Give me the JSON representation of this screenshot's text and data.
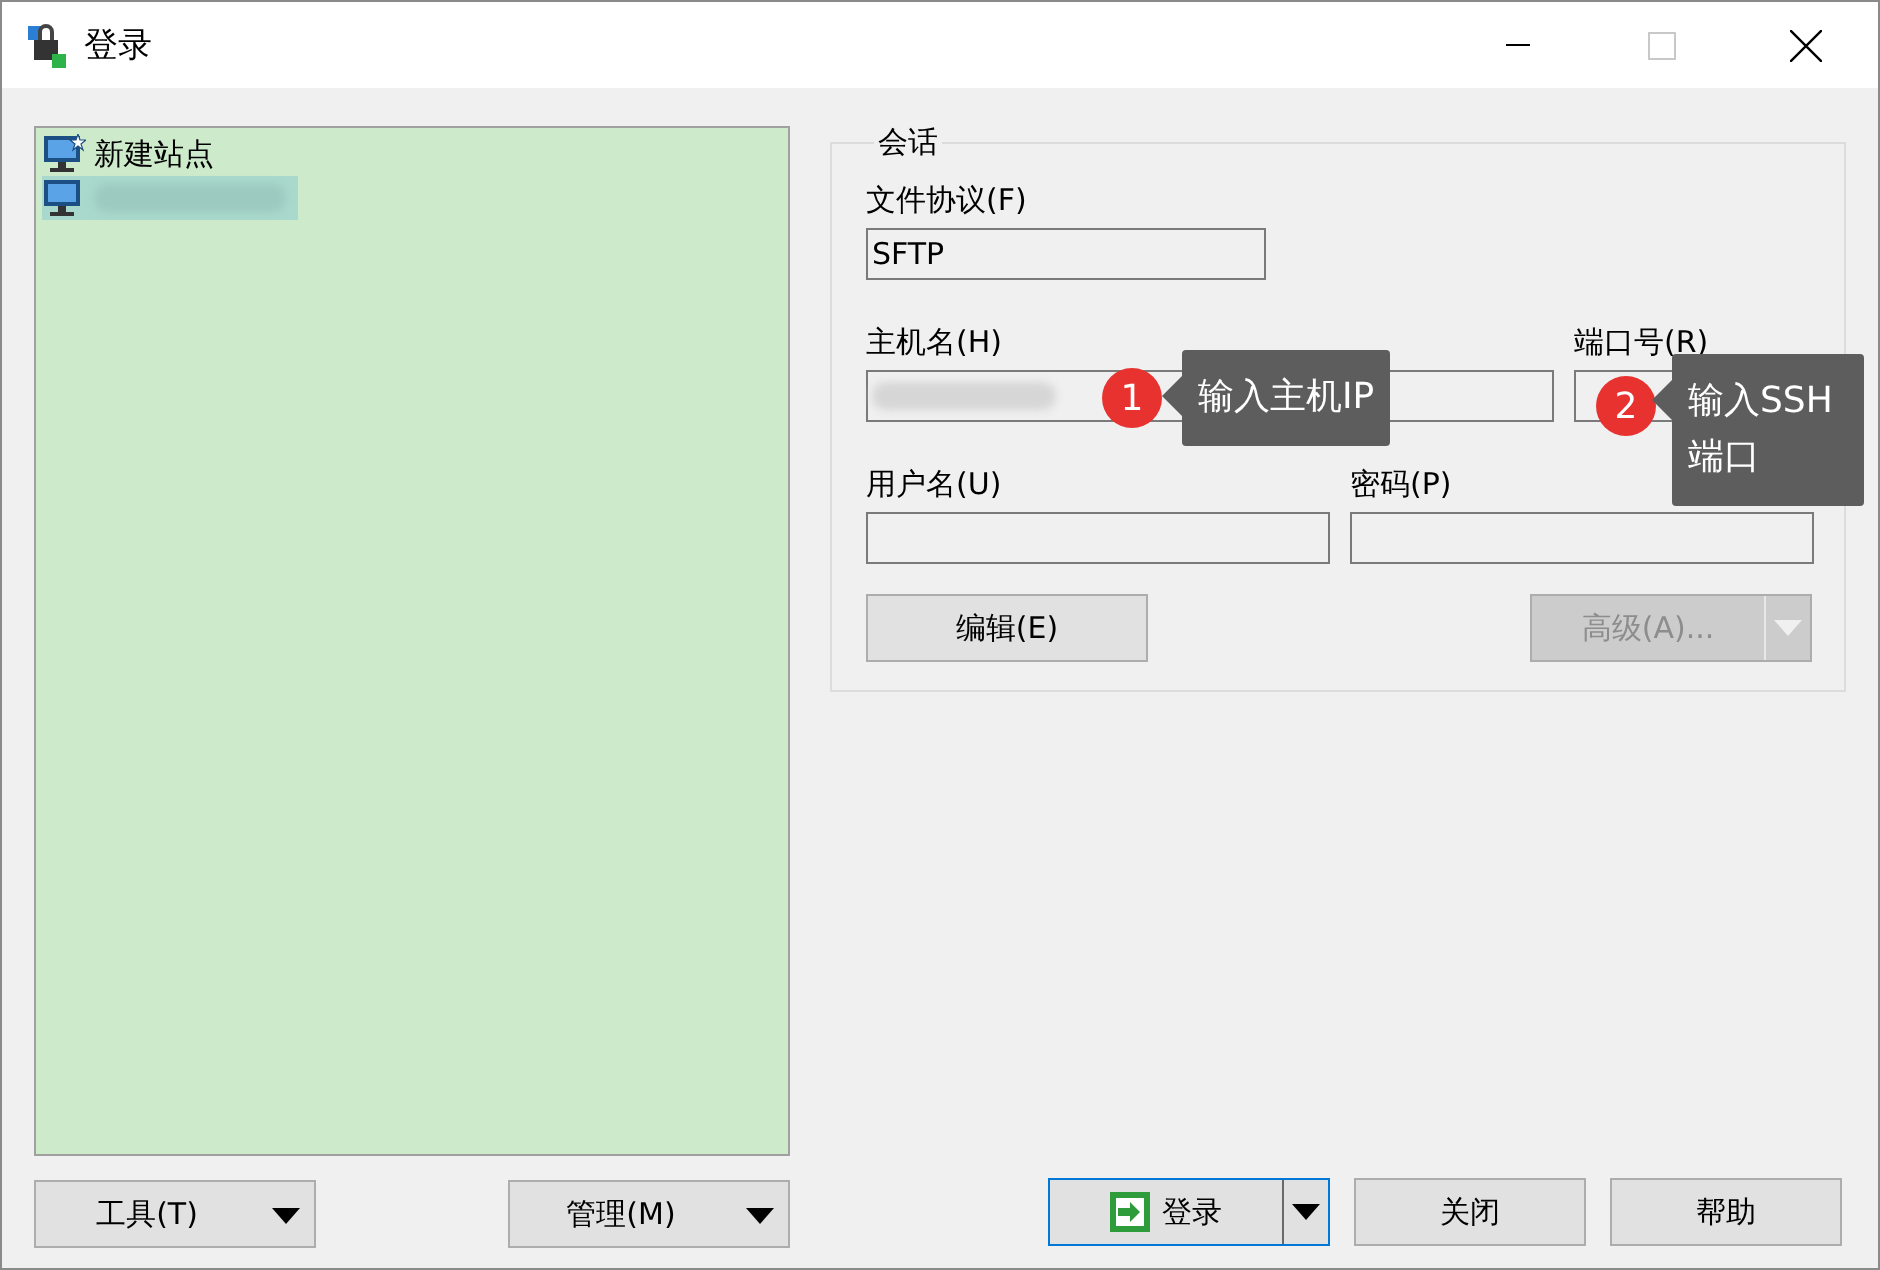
{
  "window": {
    "title": "登录"
  },
  "sites": [
    {
      "kind": "new",
      "label": "新建站点",
      "selected": false
    },
    {
      "kind": "blurred",
      "selected": true
    }
  ],
  "session": {
    "title": "会话",
    "protocol": {
      "label": "文件协议(F)",
      "value": "SFTP"
    },
    "host": {
      "label": "主机名(H)",
      "blurred": true
    },
    "port": {
      "label": "端口号(R)"
    },
    "username": {
      "label": "用户名(U)"
    },
    "password": {
      "label": "密码(P)"
    },
    "edit_button": "编辑(E)",
    "advanced_button": {
      "label": "高级(A)...",
      "disabled": true
    }
  },
  "callouts": [
    {
      "number": "1",
      "text": "输入主机IP"
    },
    {
      "number": "2",
      "text": "输入SSH端口"
    }
  ],
  "buttons": {
    "tools": "工具(T)",
    "manage": "管理(M)",
    "login": "登录",
    "close": "关闭",
    "help": "帮助"
  }
}
